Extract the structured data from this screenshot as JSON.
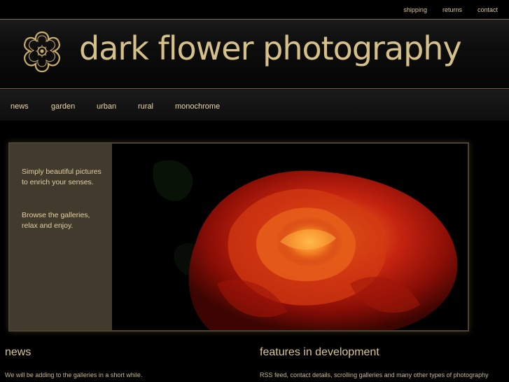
{
  "utility_nav": {
    "shipping": "shipping",
    "returns": "returns",
    "contact": "contact"
  },
  "header": {
    "title": "dark flower photography",
    "logo_icon": "flower-logo-icon"
  },
  "main_nav": [
    {
      "label": "news"
    },
    {
      "label": "garden"
    },
    {
      "label": "urban"
    },
    {
      "label": "rural"
    },
    {
      "label": "monochrome"
    }
  ],
  "hero": {
    "tagline": "Simply beautiful pictures to enrich your senses.",
    "invite": "Browse the galleries, relax and enjoy.",
    "image": "red-rose-photo"
  },
  "news": {
    "heading": "news",
    "text": "We will be adding to the galleries in a short while."
  },
  "features": {
    "heading": "features in development",
    "text": "RSS feed, contact details, scrolling galleries and many other types of photography"
  },
  "colors": {
    "accent": "#d6c08a",
    "panel": "#413b2e",
    "background": "#000000"
  }
}
